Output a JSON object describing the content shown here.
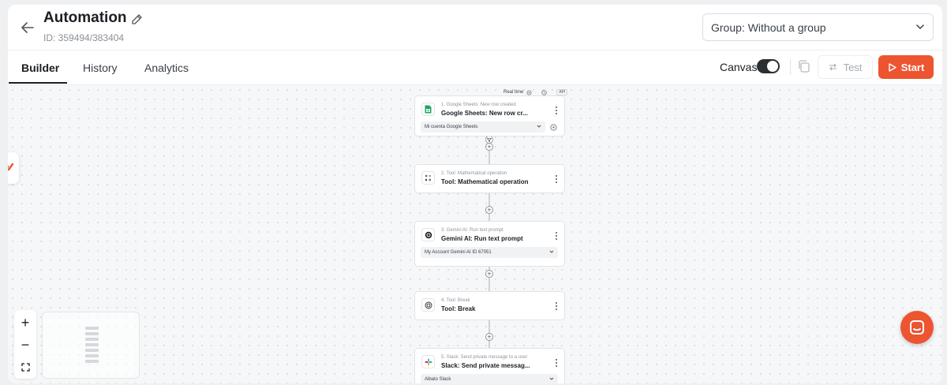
{
  "header": {
    "title": "Automation",
    "id_text": "ID: 359494/383404",
    "group_select": "Group: Without a group"
  },
  "tabs": [
    {
      "label": "Builder",
      "active": true
    },
    {
      "label": "History",
      "active": false
    },
    {
      "label": "Analytics",
      "active": false
    }
  ],
  "toolbar": {
    "canvas_label": "Canvas",
    "canvas_enabled": true,
    "test_label": "Test",
    "start_label": "Start"
  },
  "flow": {
    "realtime_label": "Real time",
    "api_badge": "API",
    "nodes": [
      {
        "subtitle": "1. Google Sheets: New row created",
        "title": "Google Sheets: New row cr...",
        "account": "Mi cuenta Google Sheets",
        "icon": "google-sheets-icon"
      },
      {
        "subtitle": "2. Tool: Mathematical operation",
        "title": "Tool: Mathematical operation",
        "account": "",
        "icon": "math-operation-icon"
      },
      {
        "subtitle": "3. Gemini AI: Run text prompt",
        "title": "Gemini AI: Run text prompt",
        "account": "My Account Gemini AI ID 67051",
        "icon": "gemini-icon"
      },
      {
        "subtitle": "4. Tool: Break",
        "title": "Tool: Break",
        "account": "",
        "icon": "break-icon"
      },
      {
        "subtitle": "5. Slack: Send private message to a user",
        "title": "Slack: Send private messag...",
        "account": "Albato Slack",
        "icon": "slack-icon"
      }
    ]
  },
  "zoom": {
    "in": "+",
    "out": "−"
  },
  "colors": {
    "accent": "#ec5530",
    "text": "#1b1f23",
    "muted": "#8a9099"
  }
}
